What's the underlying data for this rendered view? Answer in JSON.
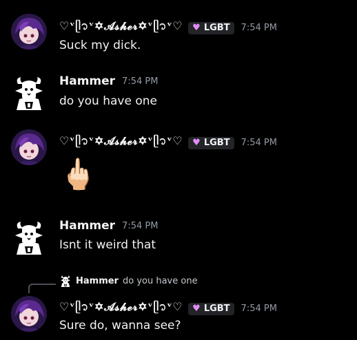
{
  "messages": [
    {
      "author": "♡ᵛᥫ᭡ᵛ✡𝓐𝓼𝓱𝓮𝓻✡ᵛᥫ᭡ᵛ♡",
      "tag": "LGBT",
      "time": "7:54 PM",
      "text": "Suck my dick."
    },
    {
      "author": "Hammer",
      "time": "7:54 PM",
      "text": "do you have one"
    },
    {
      "author": "♡ᵛᥫ᭡ᵛ✡𝓐𝓼𝓱𝓮𝓻✡ᵛᥫ᭡ᵛ♡",
      "tag": "LGBT",
      "time": "7:54 PM",
      "emoji": "🖕🏻"
    },
    {
      "author": "Hammer",
      "time": "7:54 PM",
      "text": "Isnt it weird that"
    },
    {
      "author": "♡ᵛᥫ᭡ᵛ✡𝓐𝓼𝓱𝓮𝓻✡ᵛᥫ᭡ᵛ♡",
      "tag": "LGBT",
      "time": "7:54 PM",
      "text": "Sure do, wanna see?",
      "reply": {
        "author": "Hammer",
        "text": "do you have one"
      }
    }
  ],
  "colors": {
    "background": "#000000",
    "tag_heart": "#e28cf5",
    "timestamp": "#949ba4"
  },
  "icons": {
    "tag": "heart-icon",
    "avatar_asher": "purple-anime-avatar",
    "avatar_hammer": "goat-avatar"
  }
}
